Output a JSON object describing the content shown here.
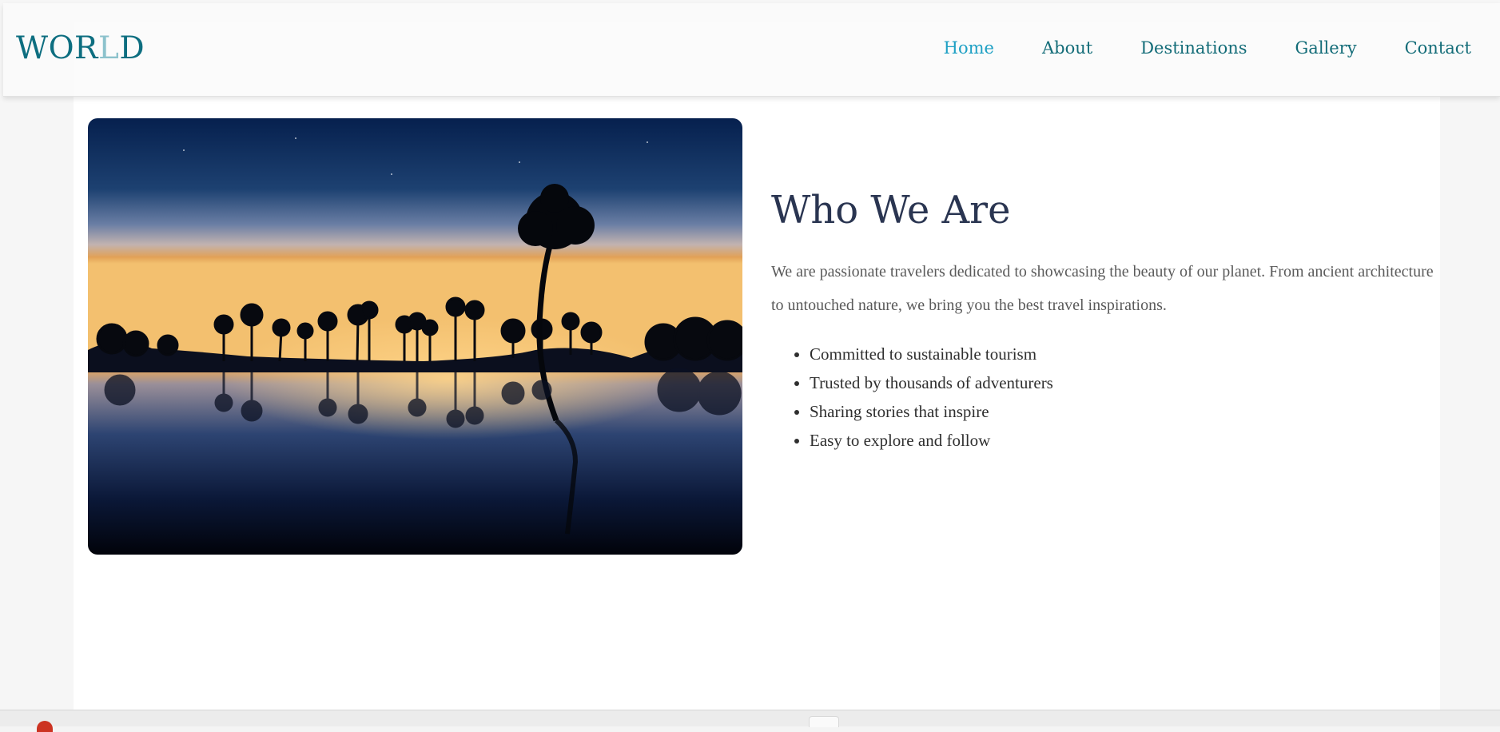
{
  "logo": {
    "text_a": "WOR",
    "text_b": "L",
    "text_c": "D"
  },
  "nav": {
    "links": [
      {
        "label": "Home",
        "active": true
      },
      {
        "label": "About"
      },
      {
        "label": "Destinations"
      },
      {
        "label": "Gallery"
      },
      {
        "label": "Contact"
      }
    ]
  },
  "about": {
    "heading": "Who We Are",
    "paragraph": "We are passionate travelers dedicated to showcasing the beauty of our planet. From ancient architecture to untouched nature, we bring you the best travel inspirations.",
    "features": [
      "Committed to sustainable tourism",
      "Trusted by thousands of adventurers",
      "Sharing stories that inspire",
      "Easy to explore and follow"
    ]
  },
  "colors": {
    "brand": "#0d6e80",
    "nav_active": "#1ea0c4",
    "heading": "#2a3551",
    "body_text": "#5a5a5a"
  },
  "icons": {
    "bottom_left": "red-circle-icon"
  }
}
